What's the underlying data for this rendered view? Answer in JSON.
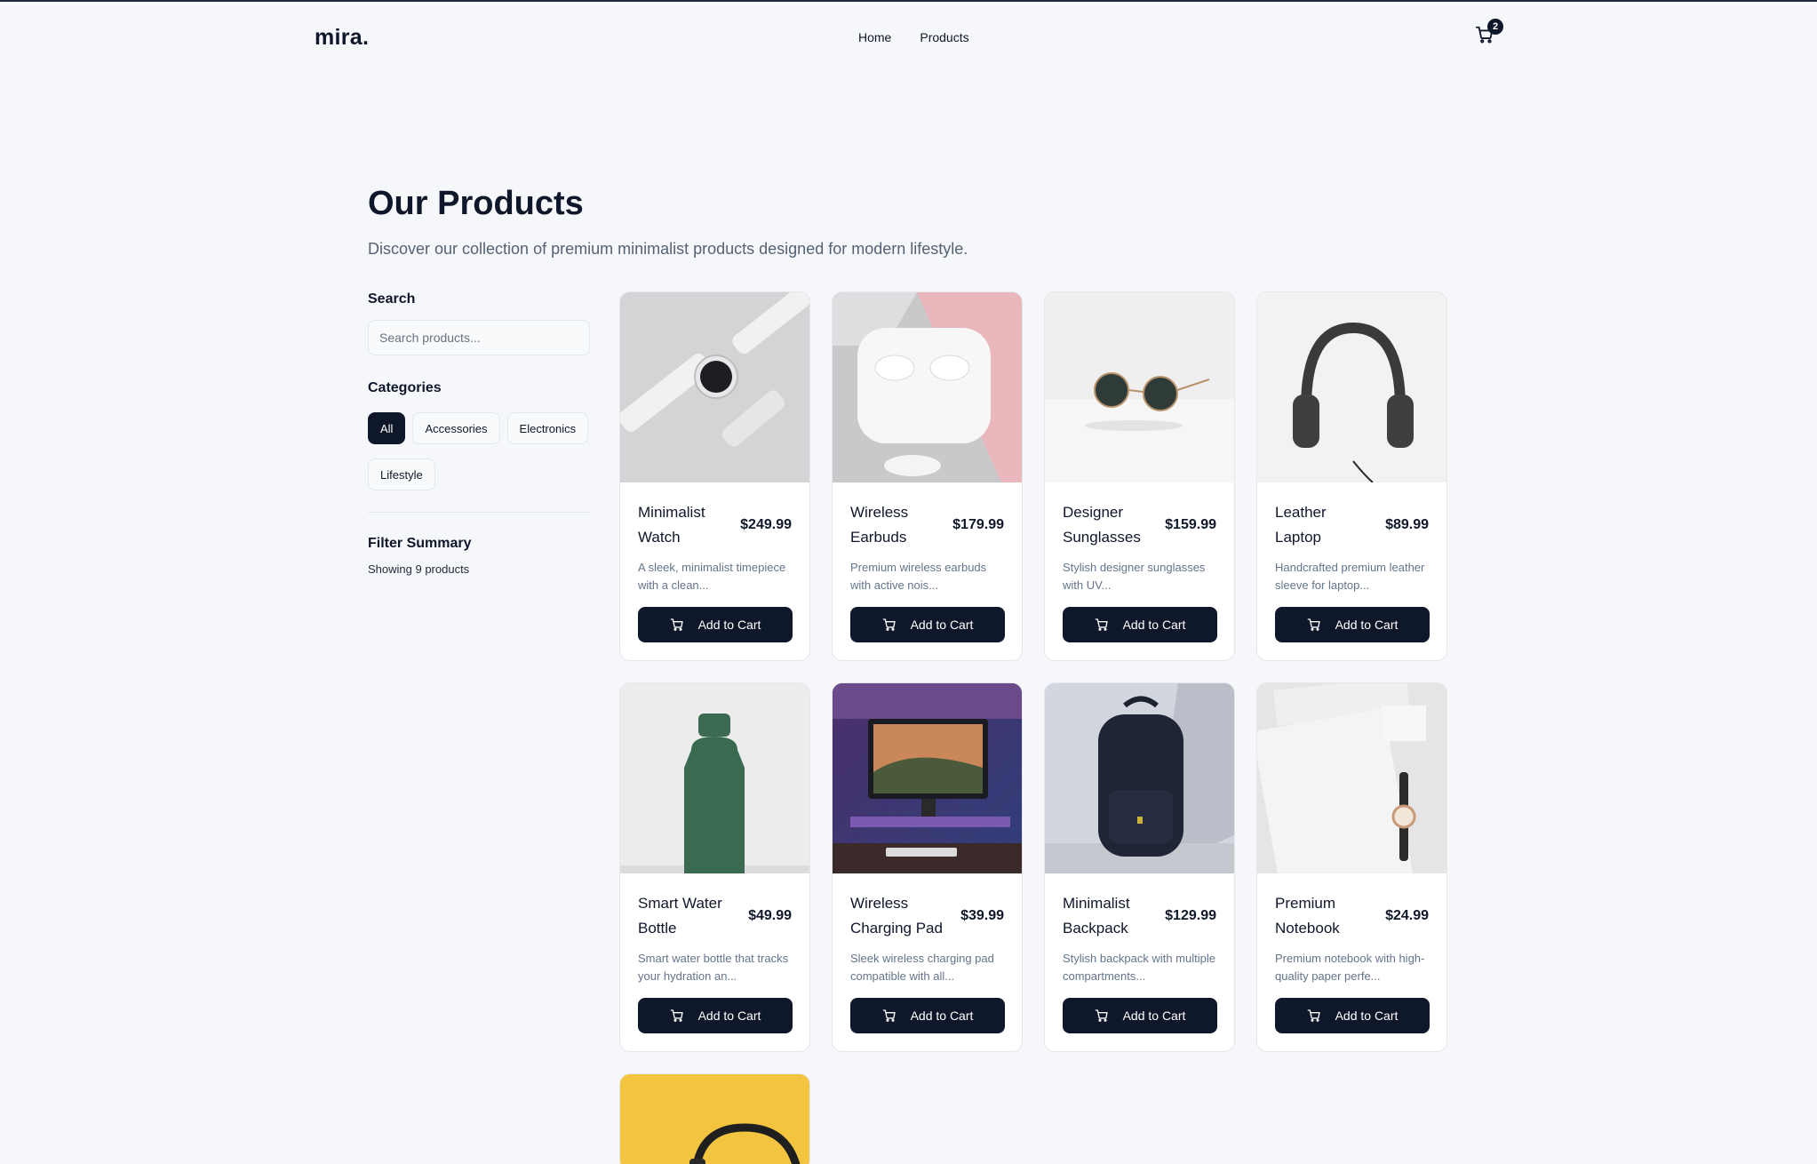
{
  "header": {
    "logo": "mira.",
    "nav": [
      {
        "label": "Home"
      },
      {
        "label": "Products"
      }
    ],
    "cart_count": "2"
  },
  "page": {
    "title": "Our Products",
    "subtitle": "Discover our collection of premium minimalist products designed for modern lifestyle."
  },
  "sidebar": {
    "search_heading": "Search",
    "search_placeholder": "Search products...",
    "categories_heading": "Categories",
    "categories": [
      {
        "label": "All",
        "active": true
      },
      {
        "label": "Accessories",
        "active": false
      },
      {
        "label": "Electronics",
        "active": false
      },
      {
        "label": "Lifestyle",
        "active": false
      }
    ],
    "filter_heading": "Filter Summary",
    "filter_count": "Showing 9 products"
  },
  "products": [
    {
      "name": "Minimalist Watch",
      "price": "$249.99",
      "desc": "A sleek, minimalist timepiece with a clean...",
      "image": "watch"
    },
    {
      "name": "Wireless Earbuds",
      "price": "$179.99",
      "desc": "Premium wireless earbuds with active nois...",
      "image": "earbuds"
    },
    {
      "name": "Designer Sunglasses",
      "price": "$159.99",
      "desc": "Stylish designer sunglasses with UV...",
      "image": "sunglasses"
    },
    {
      "name": "Leather Laptop",
      "price": "$89.99",
      "desc": "Handcrafted premium leather sleeve for laptop...",
      "image": "headphones"
    },
    {
      "name": "Smart Water Bottle",
      "price": "$49.99",
      "desc": "Smart water bottle that tracks your hydration an...",
      "image": "bottle"
    },
    {
      "name": "Wireless Charging Pad",
      "price": "$39.99",
      "desc": "Sleek wireless charging pad compatible with all...",
      "image": "desk"
    },
    {
      "name": "Minimalist Backpack",
      "price": "$129.99",
      "desc": "Stylish backpack with multiple compartments...",
      "image": "backpack"
    },
    {
      "name": "Premium Notebook",
      "price": "$24.99",
      "desc": "Premium notebook with high-quality paper perfe...",
      "image": "notebook"
    }
  ],
  "add_to_cart_label": "Add to Cart"
}
